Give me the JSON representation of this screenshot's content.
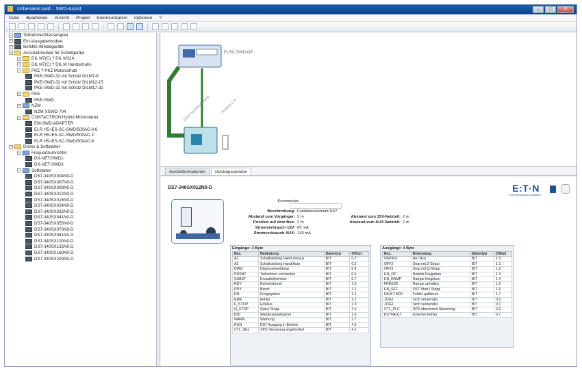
{
  "window": {
    "title": "Unbenannt.swd – SWD-Assist",
    "controls": [
      "–",
      "□",
      "✕"
    ]
  },
  "menu": [
    "Datei",
    "Bearbeiten",
    "Ansicht",
    "Projekt",
    "Kommunikation",
    "Optionen",
    "?"
  ],
  "toolbar_icons": [
    "new-icon",
    "open-icon",
    "save-icon",
    "print-icon",
    "preview-icon",
    "cut-icon",
    "copy-icon",
    "paste-icon",
    "undo-icon",
    "zoom-in-icon",
    "zoom-out-icon",
    "grid-icon",
    "layout-icon",
    "run-icon",
    "step-icon",
    "cursor-icon",
    "settings-icon",
    "help-icon"
  ],
  "tree": [
    {
      "label": "Teilnehmer/Netzadapter",
      "indent": 0,
      "icon": "net"
    },
    {
      "label": "Ein-/Ausgabemodule",
      "indent": 0,
      "icon": "device"
    },
    {
      "label": "Befehls-/Meldegeräte",
      "indent": 0,
      "icon": "device"
    },
    {
      "label": "Anschaltmodule für Schaltgeräte",
      "indent": 0,
      "icon": "folder"
    },
    {
      "label": "DIL M7(C) ? DIL M32A",
      "indent": 1,
      "icon": "folder"
    },
    {
      "label": "DIL M7(C) ? DIL M Handschuhs",
      "indent": 1,
      "icon": "folder"
    },
    {
      "label": "PKE ? PKZ Motorschutz",
      "indent": 1,
      "icon": "folder"
    },
    {
      "label": "PKE-SWD-32 mit Schütz DILM7-8",
      "indent": 2,
      "icon": "device"
    },
    {
      "label": "PKE-SWD-32 mit Schütz DILM12-15",
      "indent": 2,
      "icon": "device"
    },
    {
      "label": "PKE-SWD-32 mit Schütz DILM17-32",
      "indent": 2,
      "icon": "device"
    },
    {
      "label": "PKE",
      "indent": 1,
      "icon": "folder"
    },
    {
      "label": "PKE-SWD",
      "indent": 2,
      "icon": "device"
    },
    {
      "label": "NZM",
      "indent": 1,
      "icon": "net"
    },
    {
      "label": "NZM-XSWD-704",
      "indent": 2,
      "icon": "device"
    },
    {
      "label": "CONTACTRON Hybrid Motorstarter",
      "indent": 1,
      "icon": "folder"
    },
    {
      "label": "EM-SWD-ADAPTER",
      "indent": 2,
      "icon": "device"
    },
    {
      "label": "ELR H5-IES-SC-SWD/500AC-0.6",
      "indent": 2,
      "icon": "device"
    },
    {
      "label": "ELR H5-IES-SC-SWD/500AC-2",
      "indent": 2,
      "icon": "device"
    },
    {
      "label": "ELR H5-IES-SC-SWD/500AC-9",
      "indent": 2,
      "icon": "device"
    },
    {
      "label": "Drives & Softstarter",
      "indent": 0,
      "icon": "folder"
    },
    {
      "label": "Frequenzumrichter",
      "indent": 1,
      "icon": "net"
    },
    {
      "label": "DX-NET-SWD1",
      "indent": 2,
      "icon": "device"
    },
    {
      "label": "DX-NET-SWD3",
      "indent": 2,
      "icon": "device"
    },
    {
      "label": "Softstarter",
      "indent": 1,
      "icon": "net"
    },
    {
      "label": "DS7-340SX004N0-D",
      "indent": 2,
      "icon": "device"
    },
    {
      "label": "DS7-340SX007N0-D",
      "indent": 2,
      "icon": "device"
    },
    {
      "label": "DS7-340SX009N0-D",
      "indent": 2,
      "icon": "device"
    },
    {
      "label": "DS7-340SX012N0-D",
      "indent": 2,
      "icon": "device"
    },
    {
      "label": "DS7-340SX016N0-D",
      "indent": 2,
      "icon": "device"
    },
    {
      "label": "DS7-340SX024N0-D",
      "indent": 2,
      "icon": "device"
    },
    {
      "label": "DS7-340SX032N0-D",
      "indent": 2,
      "icon": "device"
    },
    {
      "label": "DS7-340SX041N0-D",
      "indent": 2,
      "icon": "device"
    },
    {
      "label": "DS7-340SX055N0-D",
      "indent": 2,
      "icon": "device"
    },
    {
      "label": "DS7-340SX070N0-D",
      "indent": 2,
      "icon": "device"
    },
    {
      "label": "DS7-340SX081N0-D",
      "indent": 2,
      "icon": "device"
    },
    {
      "label": "DS7-340SX100N0-D",
      "indent": 2,
      "icon": "device"
    },
    {
      "label": "DS7-340SX135N0-D",
      "indent": 2,
      "icon": "device"
    },
    {
      "label": "DS7-340SX160N0-D",
      "indent": 2,
      "icon": "device"
    },
    {
      "label": "DS7-340SX200N0-D",
      "indent": 2,
      "icon": "device"
    }
  ],
  "diagram": {
    "gateway_label": "EU5C-SWD-DP",
    "cable_label_1": "SWD-Flachbandleitung",
    "cable_label_2": "Abstand 2 m"
  },
  "tabs": [
    "Gerätinformationen",
    "Geräteparameter"
  ],
  "detail": {
    "device_name": "DS7-340SX012N0-D",
    "logo": "E:T·N",
    "logo_sub": "Powering Business Worldwide",
    "kommentar_label": "Kommentar:",
    "beschreibung_label": "Beschreibung:",
    "beschreibung_value": "Funktionselement DS7",
    "abstand_vorgaenger_label": "Abstand zum Vorgänger:",
    "abstand_vorgaenger_value": "2 m",
    "position_label": "Position auf dem Bus:",
    "position_value": "2 m",
    "stromverbrauch_label": "Stromverbrauch 15V:",
    "stromverbrauch_value": "85 mA",
    "stromverbrauch_aux_label": "Stromverbrauch AUX:",
    "stromverbrauch_aux_value": "130 mA",
    "abstand_15v_label": "Abstand zum 15V-Netzteil:",
    "abstand_15v_value": "2 m",
    "abstand_aux_label": "Abstand zum AUX-Netzteil:",
    "abstand_aux_value": "2 m"
  },
  "inputs_table": {
    "caption": "Eingänge: 3 Byte",
    "headers": [
      "Bez.",
      "Bedeutung",
      "Datentyp",
      "Offset"
    ],
    "rows": [
      [
        "A1",
        "Schaltstellung Hand ein/aus",
        "BIT",
        "0.2"
      ],
      [
        "A2",
        "Schaltstellung Hand/Auto",
        "BIT",
        "0.3"
      ],
      [
        "DIAG",
        "Diagnosemeldung",
        "BIT",
        "0.4"
      ],
      [
        "PRSNT",
        "Teilnehmer vorhanden",
        "BIT",
        "0.6"
      ],
      [
        "SUBST",
        "Ersatzteilnehmer",
        "BIT",
        "0.7"
      ],
      [
        "RDY",
        "Betriebsbereit",
        "BIT",
        "1.0"
      ],
      [
        "RDY",
        "Bereit",
        "BIT",
        "1.1"
      ],
      [
        "EN",
        "Freigegeben",
        "BIT",
        "2.1"
      ],
      [
        "ERR",
        "Fehler",
        "BIT",
        "2.2"
      ],
      [
        "F_STOP",
        "Ein/Aus",
        "BIT",
        "2.3"
      ],
      [
        "Q_STOP",
        "Quick Stopp",
        "BIT",
        "2.4"
      ],
      [
        "DDI",
        "Wiederanlaufsperre",
        "BIT",
        "2.6"
      ],
      [
        "WARN",
        "Warnung",
        "BIT",
        "2.7"
      ],
      [
        "RUN",
        "DS7 Ausgang in Betrieb",
        "BIT",
        "4.0"
      ],
      [
        "CTL_SEL",
        "SPS-Steuerung angefordert",
        "BIT",
        "4.1"
      ]
    ]
  },
  "outputs_table": {
    "caption": "Ausgänge: 4 Byte",
    "headers": [
      "Bez.",
      "Bedeutung",
      "Datentyp",
      "Offset"
    ],
    "rows": [
      [
        "ON/OFF",
        "An / Aus",
        "BIT",
        "1.0"
      ],
      [
        "OFF2",
        "Stop mit Z-Stopp",
        "BIT",
        "1.1"
      ],
      [
        "OFF3",
        "Stop mit Q-Stopp",
        "BIT",
        "1.2"
      ],
      [
        "EN_OP",
        "Betrieb Freigeben",
        "BIT",
        "1.3"
      ],
      [
        "EN_RAMP",
        "Rampe freigeben",
        "BIT",
        "1.4"
      ],
      [
        "FREEZE",
        "Rampe anhalten",
        "BIT",
        "1.5"
      ],
      [
        "EN_SET",
        "DS7 Start / Stopp",
        "BIT",
        "1.6"
      ],
      [
        "FAULT ACK",
        "Fehler quittieren",
        "BIT",
        "1.7"
      ],
      [
        "JOG1",
        "nicht verwendet",
        "BIT",
        "0.0"
      ],
      [
        "JOG2",
        "nicht verwendet",
        "BIT",
        "0.1"
      ],
      [
        "CTL_PLC",
        "SPS übernimmt Steuerung",
        "BIT",
        "0.2"
      ],
      [
        "EXTFAULT",
        "Externer Fehler",
        "BIT",
        "0.7"
      ]
    ]
  }
}
